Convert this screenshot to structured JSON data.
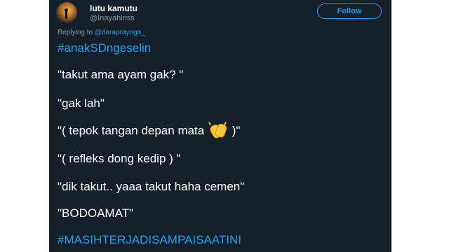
{
  "user": {
    "display_name": "lutu kamutu",
    "handle": "@Inayahinss"
  },
  "follow_button": {
    "label": "Follow"
  },
  "reply_context": {
    "prefix": "Replying to",
    "mention": "@daraprayoga_"
  },
  "tweet": {
    "hashtag_top": "#anakSDngeselin",
    "lines": [
      "\"takut ama ayam gak? \"",
      "\"gak lah\"",
      "\"( tepok tangan depan mata",
      "\"( refleks dong kedip ) \"",
      "\"dik takut.. yaaa takut haha cemen\"",
      "\"BODOAMAT\""
    ],
    "line3_suffix": ")\"",
    "hashtag_bottom": "#MASIHTERJADISAMPAISAATINI"
  },
  "colors": {
    "background": "#15202b",
    "accent": "#1da1f2",
    "secondary_text": "#8899a6",
    "primary_text": "#ffffff"
  },
  "icons": {
    "avatar": "profile-photo-silhouette",
    "emoji": "clapping-hands-icon"
  }
}
